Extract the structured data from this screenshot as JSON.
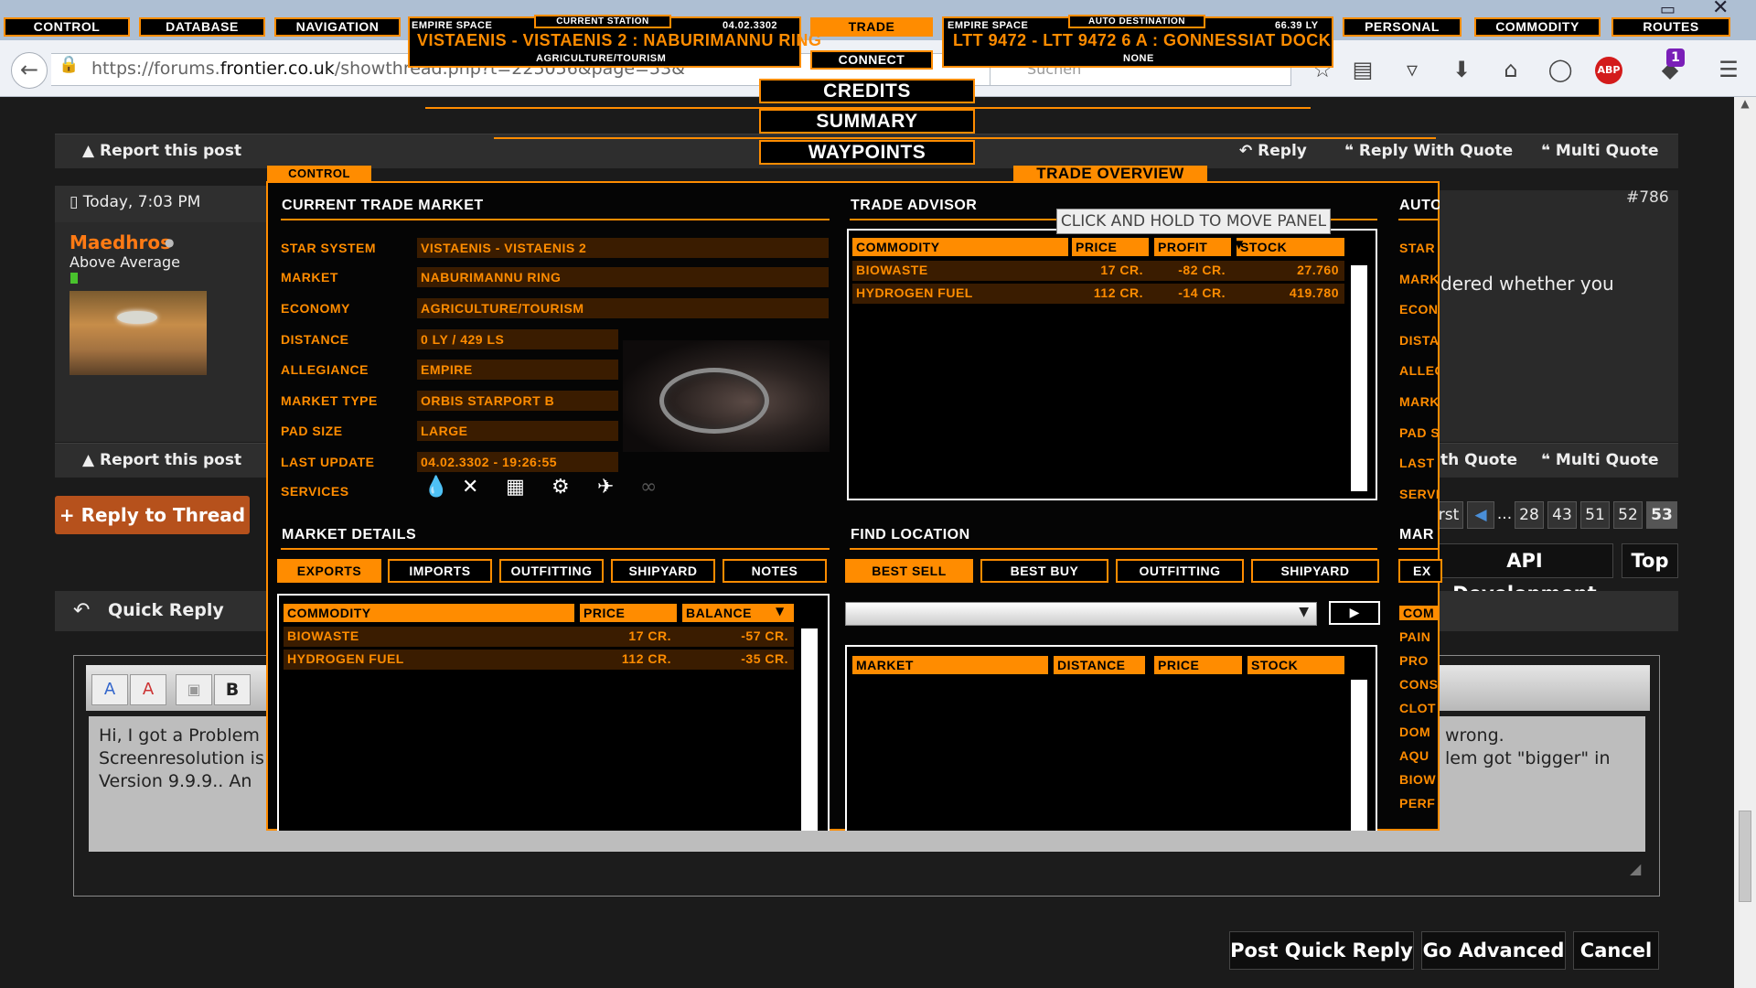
{
  "browser": {
    "url_prefix": "https://forums.",
    "url_domain": "frontier.co.uk",
    "url_suffix": "/showthread.php?t=225056&page=53&",
    "search_placeholder": "Suchen",
    "notification_count": "1",
    "abp_label": "ABP"
  },
  "elite": {
    "top_nav": [
      "CONTROL",
      "DATABASE",
      "NAVIGATION",
      "TRADE",
      "PERSONAL",
      "COMMODITY",
      "ROUTES"
    ],
    "connect": "CONNECT",
    "station": {
      "region": "EMPIRE SPACE",
      "header": "CURRENT STATION",
      "date": "04.02.3302",
      "name": "VISTAENIS - VISTAENIS 2 : NABURIMANNU RING",
      "economy": "AGRICULTURE/TOURISM"
    },
    "destination": {
      "region": "EMPIRE SPACE",
      "header": "AUTO DESTINATION",
      "distance": "66.39 LY",
      "name": "LTT 9472 - LTT 9472 6 A : GONNESSIAT DOCK",
      "economy": "NONE"
    },
    "menu": [
      "CREDITS",
      "SUMMARY",
      "WAYPOINTS"
    ],
    "panel_tab": "CONTROL",
    "panel_title": "TRADE OVERVIEW",
    "tooltip": "CLICK AND HOLD TO MOVE PANEL",
    "current_market": {
      "heading": "CURRENT TRADE MARKET",
      "fields": [
        {
          "label": "STAR SYSTEM",
          "value": "VISTAENIS - VISTAENIS 2"
        },
        {
          "label": "MARKET",
          "value": "NABURIMANNU RING"
        },
        {
          "label": "ECONOMY",
          "value": "AGRICULTURE/TOURISM"
        },
        {
          "label": "DISTANCE",
          "value": "0 LY / 429 LS"
        },
        {
          "label": "ALLEGIANCE",
          "value": "EMPIRE"
        },
        {
          "label": "MARKET TYPE",
          "value": "ORBIS STARPORT B"
        },
        {
          "label": "PAD SIZE",
          "value": "LARGE"
        },
        {
          "label": "LAST UPDATE",
          "value": "04.02.3302 - 19:26:55"
        },
        {
          "label": "SERVICES",
          "value": ""
        }
      ]
    },
    "trade_advisor": {
      "heading": "TRADE ADVISOR",
      "columns": [
        "COMMODITY",
        "PRICE",
        "PROFIT",
        "STOCK"
      ],
      "rows": [
        [
          "BIOWASTE",
          "17 CR.",
          "-82 CR.",
          "27.760"
        ],
        [
          "HYDROGEN FUEL",
          "112 CR.",
          "-14 CR.",
          "419.780"
        ]
      ]
    },
    "auto_heading": "AUTO",
    "auto_labels": [
      "STAR",
      "MARK",
      "ECON",
      "DISTA",
      "ALLEG",
      "MARK",
      "PAD S",
      "LAST",
      "SERVI"
    ],
    "market_details": {
      "heading": "MARKET DETAILS",
      "tabs": [
        "EXPORTS",
        "IMPORTS",
        "OUTFITTING",
        "SHIPYARD",
        "NOTES"
      ],
      "columns": [
        "COMMODITY",
        "PRICE",
        "BALANCE"
      ],
      "rows": [
        [
          "BIOWASTE",
          "17 CR.",
          "-57 CR."
        ],
        [
          "HYDROGEN FUEL",
          "112 CR.",
          "-35 CR."
        ]
      ]
    },
    "find_location": {
      "heading": "FIND LOCATION",
      "tabs": [
        "BEST SELL",
        "BEST BUY",
        "OUTFITTING",
        "SHIPYARD"
      ],
      "columns": [
        "MARKET",
        "DISTANCE",
        "PRICE",
        "STOCK"
      ]
    },
    "mar_heading": "MAR",
    "mar_tab": "EX",
    "mar_labels": [
      "COM",
      "PAIN",
      "PRO",
      "CONS",
      "CLOT",
      "DOM",
      "AQU",
      "BIOW",
      "PERF"
    ]
  },
  "forum": {
    "report_post": "Report this post",
    "reply": "Reply",
    "reply_with_quote": "Reply With Quote",
    "multi_quote": "Multi Quote",
    "post_date": "Today, 7:03 PM",
    "author": "Maedhros",
    "rank": "Above Average",
    "post_number": "#786",
    "post_excerpt": "dered whether you",
    "quote_partial": "th Quote",
    "reply_to_thread": "+ Reply to Thread",
    "pagination": [
      "rst",
      "...",
      "28",
      "43",
      "51",
      "52",
      "53"
    ],
    "api_dev": "API Development",
    "top": "Top",
    "quick_reply": "Quick Reply",
    "editor_left": [
      "Hi, I got a Problem",
      "Screenresolution is",
      "Version 9.9.9.. An"
    ],
    "editor_right": [
      "wrong.",
      "lem got \"bigger\" in"
    ],
    "post_quick_reply": "Post Quick Reply",
    "go_advanced": "Go Advanced",
    "cancel": "Cancel"
  }
}
